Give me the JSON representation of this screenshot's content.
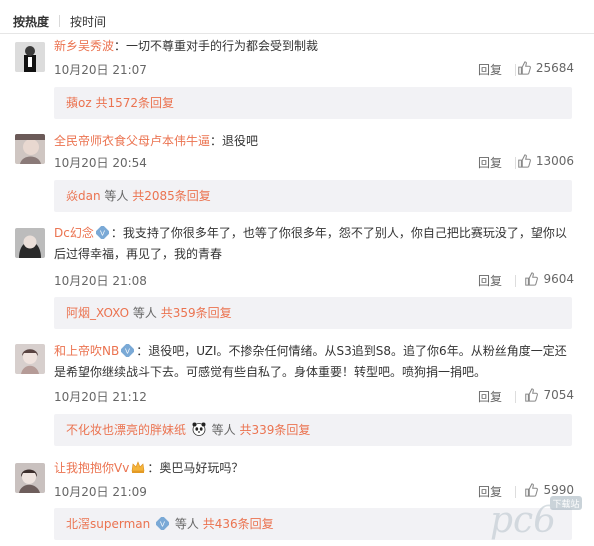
{
  "tabs": {
    "hot": "按热度",
    "time": "按时间"
  },
  "comments": [
    {
      "user": "新乡吴秀波",
      "text": "：一切不尊重对手的行为都会受到制裁",
      "time": "10月20日 21:07",
      "reply": "回复",
      "likes": "25684",
      "sub": {
        "name": "蘋oz",
        "middle": "",
        "count": "共1572条回复"
      }
    },
    {
      "user": "全民帝师衣食父母卢本伟牛逼",
      "text": "：退役吧",
      "time": "10月20日 20:54",
      "reply": "回复",
      "likes": "13006",
      "sub": {
        "name": "焱dan",
        "middle": "等人",
        "count": "共2085条回复"
      }
    },
    {
      "user": "Dc幻念",
      "text_line1": "：我支持了你很多年了，也等了你很多年，怨不了别人，你自己把比赛玩没了，望你以",
      "text_line2": "后过得幸福，再见了，我的青春",
      "time": "10月20日 21:08",
      "reply": "回复",
      "likes": "9604",
      "sub": {
        "name": "阿烟_XOXO",
        "middle": "等人",
        "count": "共359条回复"
      }
    },
    {
      "user": "和上帝吹NB",
      "text_line1": "：退役吧，UZI。不掺杂任何情绪。从S3追到S8。追了你6年。从粉丝角度一定还",
      "text_line2": "是希望你继续战斗下去。可感觉有些自私了。身体重要！转型吧。喷狗捐一捐吧。",
      "time": "10月20日 21:12",
      "reply": "回复",
      "likes": "7054",
      "sub": {
        "name": "不化妆也漂亮的胖妹纸",
        "middle": "等人",
        "count": "共339条回复"
      }
    },
    {
      "user": "让我抱抱你Vv",
      "text": "：奥巴马好玩吗？",
      "time": "10月20日 21:09",
      "reply": "回复",
      "likes": "5990",
      "sub": {
        "name": "北滘superman",
        "middle": "等人",
        "count": "共436条回复"
      }
    }
  ],
  "watermark": {
    "text": "pc6",
    "sub": "下载站"
  },
  "colors": {
    "accent": "#eb7350",
    "subbox_bg": "#f2f2f5",
    "text": "#333333",
    "meta": "#666666"
  },
  "icons": {
    "like": "thumbs-up-icon",
    "vip": "vip-badge-icon",
    "panda": "panda-emoji-icon",
    "crown": "crown-emoji-icon"
  }
}
